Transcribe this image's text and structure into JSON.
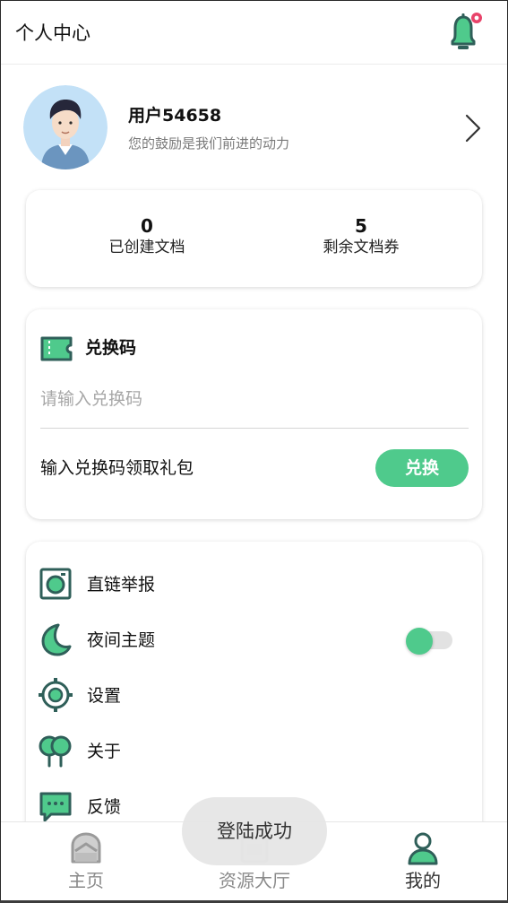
{
  "header": {
    "title": "个人中心",
    "notification_icon": "bell-icon",
    "has_unread_dot": true
  },
  "user": {
    "name": "用户54658",
    "subtitle": "您的鼓励是我们前进的动力"
  },
  "stats": [
    {
      "value": "0",
      "label": "已创建文档"
    },
    {
      "value": "5",
      "label": "剩余文档券"
    }
  ],
  "redeem": {
    "title": "兑换码",
    "placeholder": "请输入兑换码",
    "hint": "输入兑换码领取礼包",
    "button": "兑换"
  },
  "menu": [
    {
      "label": "直链举报",
      "icon": "report-icon"
    },
    {
      "label": "夜间主题",
      "icon": "moon-icon",
      "toggle": true,
      "toggle_on": false
    },
    {
      "label": "设置",
      "icon": "settings-icon"
    },
    {
      "label": "关于",
      "icon": "about-icon"
    },
    {
      "label": "反馈",
      "icon": "feedback-icon"
    }
  ],
  "nav": [
    {
      "label": "主页",
      "icon": "home-icon",
      "active": false
    },
    {
      "label": "资源大厅",
      "icon": "resource-hall-icon",
      "active": false
    },
    {
      "label": "我的",
      "icon": "profile-icon",
      "active": true
    }
  ],
  "toast": "登陆成功",
  "colors": {
    "accent": "#4fca8c",
    "icon_dark": "#2f5f59",
    "notify_dot": "#e8436a"
  }
}
